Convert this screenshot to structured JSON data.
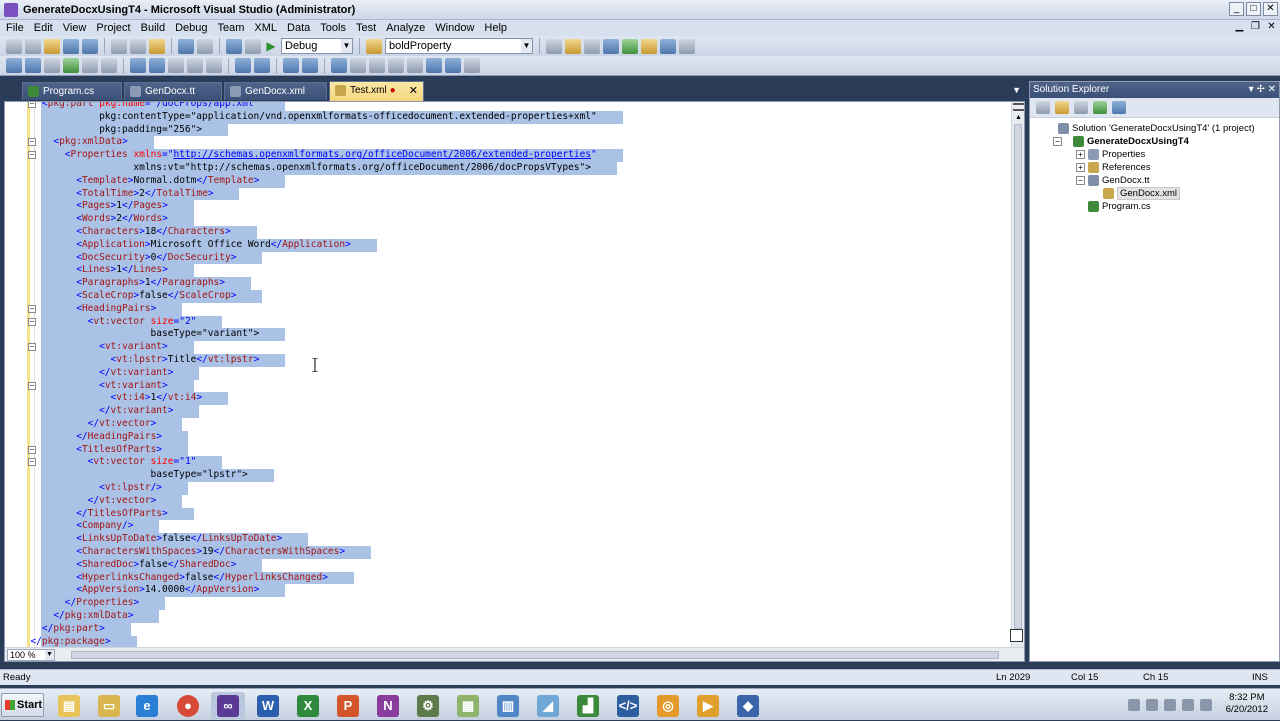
{
  "window": {
    "title": "GenerateDocxUsingT4 - Microsoft Visual Studio (Administrator)"
  },
  "menu": [
    "File",
    "Edit",
    "View",
    "Project",
    "Build",
    "Debug",
    "Team",
    "XML",
    "Data",
    "Tools",
    "Test",
    "Analyze",
    "Window",
    "Help"
  ],
  "toolbar": {
    "config": "Debug",
    "find": "boldProperty"
  },
  "tabs": [
    {
      "label": "Program.cs",
      "active": false
    },
    {
      "label": "GenDocx.tt",
      "active": false
    },
    {
      "label": "GenDocx.xml",
      "active": false
    },
    {
      "label": "Test.xml",
      "active": true,
      "dirty": true
    }
  ],
  "code_lines": [
    "    <pkg:part pkg:name=\"/docProps/app.xml\"",
    "              pkg:contentType=\"application/vnd.openxmlformats-officedocument.extended-properties+xml\"",
    "              pkg:padding=\"256\">",
    "      <pkg:xmlData>",
    "        <Properties xmlns=\"http://schemas.openxmlformats.org/officeDocument/2006/extended-properties\"",
    "                    xmlns:vt=\"http://schemas.openxmlformats.org/officeDocument/2006/docPropsVTypes\">",
    "          <Template>Normal.dotm</Template>",
    "          <TotalTime>2</TotalTime>",
    "          <Pages>1</Pages>",
    "          <Words>2</Words>",
    "          <Characters>18</Characters>",
    "          <Application>Microsoft Office Word</Application>",
    "          <DocSecurity>0</DocSecurity>",
    "          <Lines>1</Lines>",
    "          <Paragraphs>1</Paragraphs>",
    "          <ScaleCrop>false</ScaleCrop>",
    "          <HeadingPairs>",
    "            <vt:vector size=\"2\"",
    "                       baseType=\"variant\">",
    "              <vt:variant>",
    "                <vt:lpstr>Title</vt:lpstr>",
    "              </vt:variant>",
    "              <vt:variant>",
    "                <vt:i4>1</vt:i4>",
    "              </vt:variant>",
    "            </vt:vector>",
    "          </HeadingPairs>",
    "          <TitlesOfParts>",
    "            <vt:vector size=\"1\"",
    "                       baseType=\"lpstr\">",
    "              <vt:lpstr/>",
    "            </vt:vector>",
    "          </TitlesOfParts>",
    "          <Company/>",
    "          <LinksUpToDate>false</LinksUpToDate>",
    "          <CharactersWithSpaces>19</CharactersWithSpaces>",
    "          <SharedDoc>false</SharedDoc>",
    "          <HyperlinksChanged>false</HyperlinksChanged>",
    "          <AppVersion>14.0000</AppVersion>",
    "        </Properties>",
    "      </pkg:xmlData>",
    "    </pkg:part>",
    "  </pkg:package>"
  ],
  "folds": [
    0,
    3,
    4,
    16,
    17,
    19,
    22,
    27,
    28
  ],
  "zoom": "100 %",
  "solution_explorer": {
    "title": "Solution Explorer",
    "items": [
      {
        "label": "Solution 'GenerateDocxUsingT4' (1 project)",
        "level": 0,
        "exp": "",
        "icon": "solution-icon"
      },
      {
        "label": "GenerateDocxUsingT4",
        "level": 1,
        "exp": "-",
        "bold": true,
        "icon": "project-icon"
      },
      {
        "label": "Properties",
        "level": 2,
        "exp": "+",
        "icon": "properties-icon"
      },
      {
        "label": "References",
        "level": 2,
        "exp": "+",
        "icon": "references-icon"
      },
      {
        "label": "GenDocx.tt",
        "level": 2,
        "exp": "-",
        "icon": "tt-file-icon"
      },
      {
        "label": "GenDocx.xml",
        "level": 3,
        "exp": "",
        "selected": true,
        "icon": "xml-file-icon"
      },
      {
        "label": "Program.cs",
        "level": 2,
        "exp": "",
        "icon": "cs-file-icon"
      }
    ]
  },
  "status": {
    "ready": "Ready",
    "ln": "Ln 2029",
    "col": "Col 15",
    "ch": "Ch 15",
    "mode": "INS"
  },
  "taskbar": {
    "start": "Start",
    "time": "8:32 PM",
    "date": "6/20/2012"
  },
  "colors": {
    "accent": "#2b3c59",
    "selection": "#a9c2e6",
    "tag": "#a31515",
    "attr": "#ff0000",
    "value": "#0000ff"
  }
}
